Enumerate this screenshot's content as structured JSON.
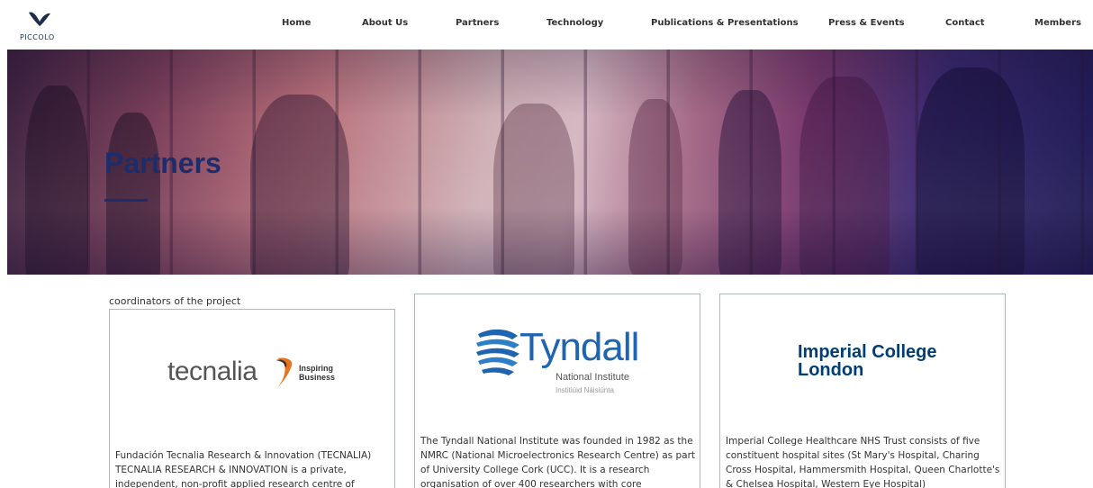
{
  "header": {
    "logo_text": "PICCOLO",
    "nav": [
      {
        "label": "Home"
      },
      {
        "label": "About Us"
      },
      {
        "label": "Partners"
      },
      {
        "label": "Technology"
      },
      {
        "label": "Publications & Presentations"
      },
      {
        "label": "Press & Events"
      },
      {
        "label": "Contact"
      },
      {
        "label": "Members"
      }
    ]
  },
  "hero": {
    "title": "Partners"
  },
  "partners": {
    "caption": "coordinators of the project",
    "cards": [
      {
        "logo": {
          "word": "tecnalia",
          "tagline_1": "Inspiring",
          "tagline_2": "Business"
        },
        "text": "Fundación Tecnalia Research & Innovation (TECNALIA) TECNALIA RESEARCH & INNOVATION is a private, independent, non-profit applied research centre of"
      },
      {
        "logo": {
          "word": "Tyndall",
          "sub_1": "National Institute",
          "sub_2": "Institiúid Náisiúnta"
        },
        "text": "The Tyndall National Institute was founded in 1982 as the NMRC (National Microelectronics Research Centre) as part of University College Cork (UCC). It is a research organisation of over 400 researchers with core"
      },
      {
        "logo": {
          "line_1": "Imperial College",
          "line_2": "London"
        },
        "text": "Imperial College Healthcare NHS Trust consists of five constituent hospital sites (St Mary's Hospital, Charing Cross Hospital, Hammersmith Hospital, Queen Charlotte's & Chelsea Hospital, Western Eye Hospital)"
      }
    ]
  },
  "colors": {
    "brand_navy": "#1d2d6b",
    "tyndall_blue": "#1f64b0",
    "imperial_blue": "#003e74",
    "tecnalia_orange": "#e8731f"
  }
}
